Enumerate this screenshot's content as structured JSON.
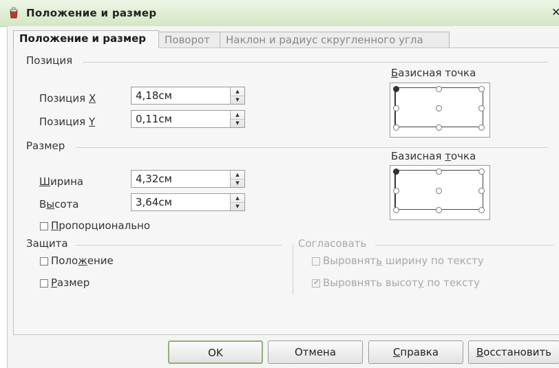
{
  "window": {
    "title": "Положение и размер",
    "close_glyph": "✕",
    "icon": "app-icon"
  },
  "tabs": [
    {
      "label": "Положение и размер",
      "active": true
    },
    {
      "label": "Поворот",
      "active": false
    },
    {
      "label": "Наклон и радиус скругленного угла",
      "active": false
    }
  ],
  "position": {
    "section": "Позиция",
    "x": {
      "label_pre": "Позиция ",
      "label_u": "X",
      "label_post": "",
      "value": "4,18см"
    },
    "y": {
      "label_pre": "Позиция ",
      "label_u": "Y",
      "label_post": "",
      "value": "0,11см"
    },
    "base_point": {
      "pre": "",
      "u": "Б",
      "post": "азисная точка",
      "selected": "top-left"
    }
  },
  "size": {
    "section": "Размер",
    "width": {
      "label_pre": "",
      "label_u": "Ш",
      "label_post": "ирина",
      "value": "4,32см"
    },
    "height": {
      "label_pre": "В",
      "label_u": "ы",
      "label_post": "сота",
      "value": "3,64см"
    },
    "keep_ratio": {
      "label_pre": "",
      "label_u": "П",
      "label_post": "ропорционально",
      "checked": false
    },
    "base_point": {
      "pre": "Базисная ",
      "u": "т",
      "post": "очка",
      "selected": "top-left"
    }
  },
  "protect": {
    "section": "Защита",
    "position": {
      "label_pre": "Поло",
      "label_u": "ж",
      "label_post": "ение",
      "checked": false
    },
    "size": {
      "label_pre": "",
      "label_u": "Р",
      "label_post": "азмер",
      "checked": false
    }
  },
  "adapt": {
    "section": "Согласовать",
    "fit_width": {
      "label_pre": "Выровнят",
      "label_u": "ь",
      "label_post": " ширину по тексту",
      "checked": false,
      "enabled": false
    },
    "fit_height": {
      "label_pre": "Выровнять высот",
      "label_u": "у",
      "label_post": " по тексту",
      "checked": true,
      "enabled": false
    }
  },
  "buttons": {
    "ok": "OK",
    "cancel": "Отмена",
    "help": {
      "pre": "",
      "u": "С",
      "post": "правка"
    },
    "reset": {
      "pre": "",
      "u": "В",
      "post": "осстановить"
    }
  },
  "colors": {
    "titlebar": "#d3e6c3",
    "default_button_border": "#8fb07c"
  }
}
